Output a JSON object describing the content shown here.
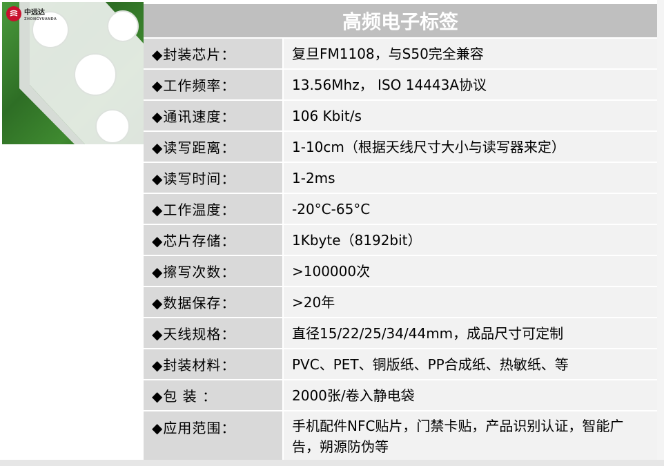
{
  "logo": {
    "name": "中远达",
    "sub": "ZHONGYUANDA"
  },
  "title": "高频电子标签",
  "rows": [
    {
      "label": "◆封装芯片：",
      "value": "复旦FM1108，与S50完全兼容"
    },
    {
      "label": "◆工作频率：",
      "value": "13.56Mhz， ISO 14443A协议"
    },
    {
      "label": "◆通讯速度：",
      "value": "106 Kbit/s"
    },
    {
      "label": "◆读写距离：",
      "value": "1-10cm（根据天线尺寸大小与读写器来定）"
    },
    {
      "label": "◆读写时间：",
      "value": "1-2ms"
    },
    {
      "label": "◆工作温度：",
      "value": "-20°C-65°C"
    },
    {
      "label": "◆芯片存储：",
      "value": "1Kbyte（8192bit）"
    },
    {
      "label": "◆擦写次数：",
      "value": ">100000次"
    },
    {
      "label": "◆数据保存：",
      "value": ">20年"
    },
    {
      "label": "◆天线规格：",
      "value": "直径15/22/25/34/44mm，成品尺寸可定制"
    },
    {
      "label": "◆封装材料：",
      "value": "PVC、PET、铜版纸、PP合成纸、热敏纸、等"
    },
    {
      "label": "◆包    装 ：",
      "value": "2000张/卷入静电袋"
    },
    {
      "label": "◆应用范围：",
      "value": "手机配件NFC贴片，门禁卡贴，产品识别认证，智能广告，朔源防伪等"
    }
  ],
  "colors": {
    "header_bg": "#bfbfbf",
    "label_bg": "#d9d9d9",
    "value_bg": "#f2f2f2"
  }
}
